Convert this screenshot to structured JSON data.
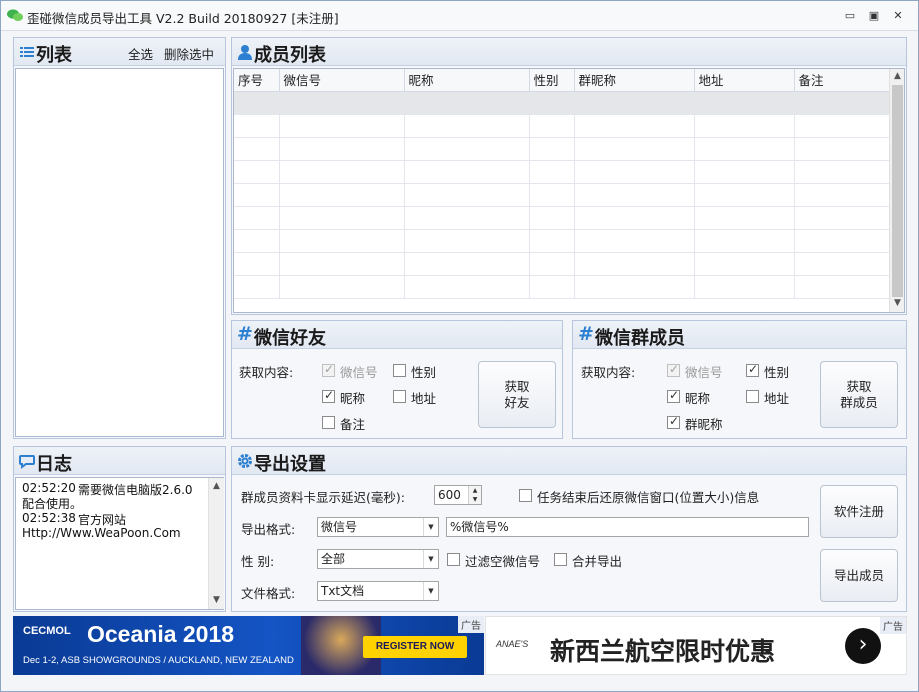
{
  "window": {
    "title": "歪碰微信成员导出工具 V2.2 Build 20180927    [未注册]",
    "controls": {
      "minimize": "▭",
      "restore": "▣",
      "close": "✕"
    }
  },
  "list_panel": {
    "title": "列表",
    "select_all": "全选",
    "delete_selected": "删除选中"
  },
  "members_panel": {
    "title": "成员列表",
    "columns": [
      "序号",
      "微信号",
      "昵称",
      "性别",
      "群昵称",
      "地址",
      "备注"
    ]
  },
  "friends_panel": {
    "title": "微信好友",
    "fetch_label": "获取内容:",
    "options": {
      "wechat_id": {
        "label": "微信号",
        "checked": true,
        "disabled": true
      },
      "gender": {
        "label": "性别",
        "checked": false
      },
      "nickname": {
        "label": "昵称",
        "checked": true
      },
      "address": {
        "label": "地址",
        "checked": false
      },
      "remark": {
        "label": "备注",
        "checked": false
      }
    },
    "button": "获取\n好友"
  },
  "group_panel": {
    "title": "微信群成员",
    "fetch_label": "获取内容:",
    "options": {
      "wechat_id": {
        "label": "微信号",
        "checked": true,
        "disabled": true
      },
      "gender": {
        "label": "性别",
        "checked": true
      },
      "nickname": {
        "label": "昵称",
        "checked": true
      },
      "address": {
        "label": "地址",
        "checked": false
      },
      "group_nickname": {
        "label": "群昵称",
        "checked": true
      }
    },
    "button": "获取\n群成员"
  },
  "log_panel": {
    "title": "日志",
    "entries": [
      {
        "time": "02:52:20",
        "text": "需要微信电脑版2.6.0",
        "cont": "配合使用。"
      },
      {
        "time": "02:52:38",
        "text": "官方网站",
        "cont": "Http://Www.WeaPoon.Com"
      }
    ]
  },
  "export_panel": {
    "title": "导出设置",
    "delay_label": "群成员资料卡显示延迟(毫秒):",
    "delay_value": "600",
    "restore_label": "任务结束后还原微信窗口(位置大小)信息",
    "format_label": "导出格式:",
    "format_value": "微信号",
    "format_text": "%微信号%",
    "gender_label": "性    别:",
    "gender_value": "全部",
    "filter_empty_label": "过滤空微信号",
    "merge_label": "合并导出",
    "file_format_label": "文件格式:",
    "file_format_value": "Txt文档",
    "register_button": "软件注册",
    "export_button": "导出成员"
  },
  "ads": {
    "left": {
      "brand": "CECMOL",
      "headline": "Oceania 2018",
      "register": "REGISTER NOW",
      "sub": "Dec 1-2, ASB SHOWGROUNDS / AUCKLAND, NEW ZEALAND",
      "tag": "广告"
    },
    "right": {
      "logo": "ANAE'S",
      "headline": "新西兰航空限时优惠",
      "tag": "广告"
    }
  },
  "colors": {
    "accent": "#2c7fd1",
    "ad_blue": "#0d3f9a",
    "ad_yellow": "#ffd200"
  }
}
